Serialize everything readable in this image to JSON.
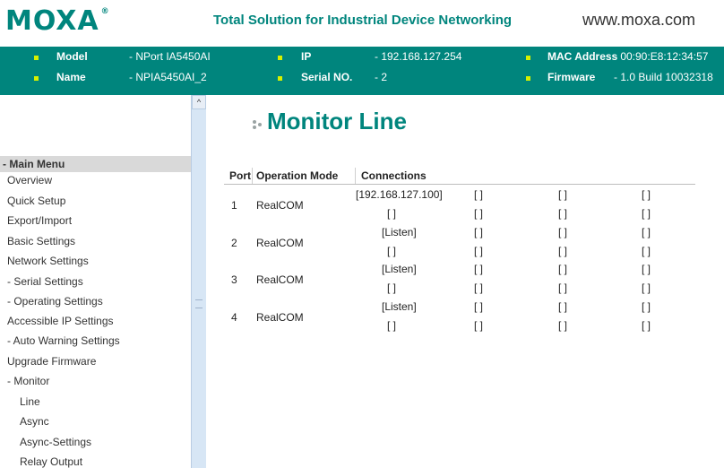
{
  "brand": {
    "logo": "MOXA",
    "logo_mark": "®",
    "tagline": "Total Solution for Industrial Device Networking",
    "website": "www.moxa.com"
  },
  "device_info": {
    "model_label": "Model",
    "model_value": "- NPort IA5450AI",
    "name_label": "Name",
    "name_value": "- NPIA5450AI_2",
    "ip_label": "IP",
    "ip_value": "- 192.168.127.254",
    "serial_label": "Serial NO.",
    "serial_value": "- 2",
    "mac_label": "MAC Address",
    "mac_value": "- 00:90:E8:12:34:57",
    "firmware_label": "Firmware",
    "firmware_value": "- 1.0 Build 10032318"
  },
  "sidebar": {
    "head": "- Main Menu",
    "items": [
      {
        "label": "Overview"
      },
      {
        "label": "Quick Setup"
      },
      {
        "label": "Export/Import"
      },
      {
        "label": "Basic Settings"
      },
      {
        "label": "Network Settings"
      },
      {
        "label": "- Serial Settings"
      },
      {
        "label": "- Operating Settings"
      },
      {
        "label": "Accessible IP Settings"
      },
      {
        "label": "- Auto Warning Settings"
      },
      {
        "label": "Upgrade Firmware"
      },
      {
        "label": "- Monitor"
      },
      {
        "label": "Line"
      },
      {
        "label": "Async"
      },
      {
        "label": "Async-Settings"
      },
      {
        "label": "Relay Output"
      }
    ],
    "scroll_up": "^"
  },
  "main": {
    "title": "Monitor Line",
    "columns": {
      "port": "Port",
      "mode": "Operation Mode",
      "connections": "Connections"
    },
    "rows": [
      {
        "port": "1",
        "mode": "RealCOM",
        "first_conn": "[192.168.127.100]",
        "empty": "[ ]"
      },
      {
        "port": "2",
        "mode": "RealCOM",
        "first_conn": "[Listen]",
        "empty": "[ ]"
      },
      {
        "port": "3",
        "mode": "RealCOM",
        "first_conn": "[Listen]",
        "empty": "[ ]"
      },
      {
        "port": "4",
        "mode": "RealCOM",
        "first_conn": "[Listen]",
        "empty": "[ ]"
      }
    ]
  },
  "colors": {
    "accent": "#00857d",
    "bullet": "#d6f000"
  }
}
